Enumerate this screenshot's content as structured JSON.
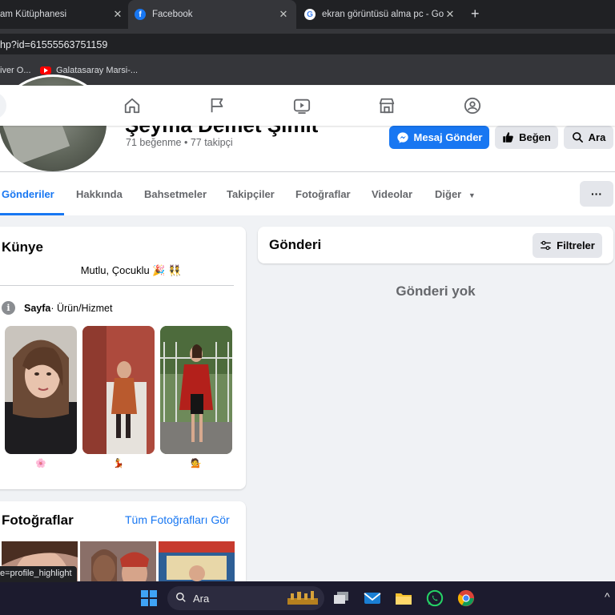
{
  "browser": {
    "tabs": [
      {
        "title": "am Kütüphanesi",
        "close": "✕"
      },
      {
        "title": "Facebook",
        "close": "✕"
      },
      {
        "title": "ekran görüntüsü alma pc - Goo",
        "close": "✕"
      }
    ],
    "new_tab": "+",
    "url": "hp?id=61555563751159",
    "bookmarks": [
      {
        "label": "iver O..."
      },
      {
        "label": "Galatasaray Marsi-..."
      }
    ]
  },
  "fb_nav": {
    "icons": [
      "home-icon",
      "flag-icon",
      "video-icon",
      "marketplace-icon",
      "groups-icon"
    ]
  },
  "profile": {
    "name": "Şeyma Demet Şimit",
    "stats": "71 beğenme • 77 takipçi",
    "buttons": {
      "message": "Mesaj Gönder",
      "like": "Beğen",
      "call": "Ara"
    },
    "tabs": [
      "Gönderiler",
      "Hakkında",
      "Bahsetmeler",
      "Takipçiler",
      "Fotoğraflar",
      "Videolar",
      "Diğer"
    ],
    "more": "···"
  },
  "intro": {
    "title": "Künye",
    "bio": "Mutlu, Çocuklu 🎉 👯",
    "category_label": "Sayfa",
    "category_value": " · Ürün/Hizmet",
    "highlight_emojis": [
      "🌸",
      "💃",
      "💁"
    ]
  },
  "photos": {
    "title": "Fotoğraflar",
    "see_all": "Tüm Fotoğrafları Gör"
  },
  "posts": {
    "title": "Gönderi",
    "filter": "Filtreler",
    "empty": "Gönderi yok"
  },
  "status_url": "e=profile_highlight",
  "taskbar": {
    "search_label": "Ara",
    "chevron": "^"
  }
}
